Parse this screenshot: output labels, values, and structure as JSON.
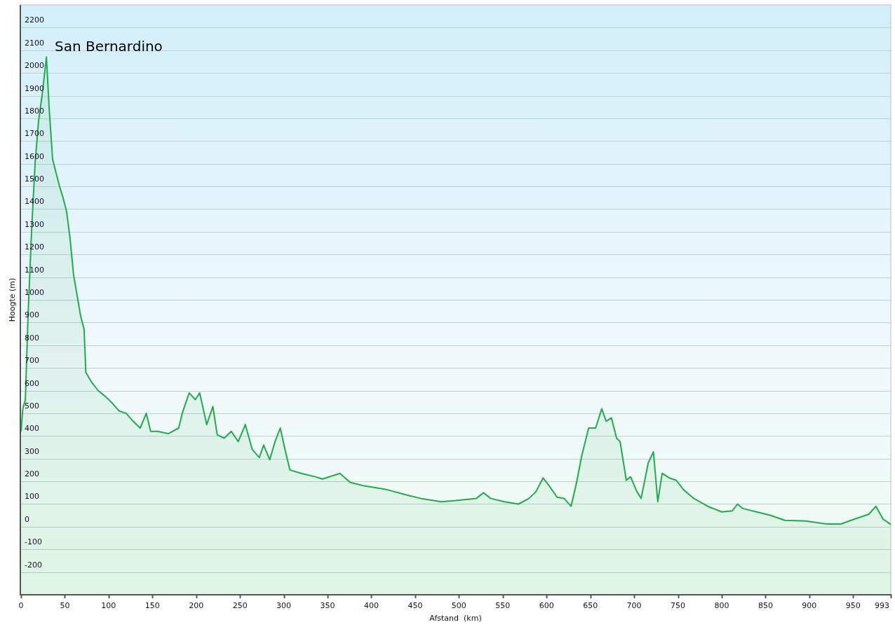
{
  "chart": {
    "chart_data": {
      "type": "line",
      "title": "San Bernardino",
      "xlabel": "Afstand  (km)",
      "ylabel": "Hoogte (m)",
      "grid": true,
      "xlim": [
        0,
        993
      ],
      "ylim": [
        -300,
        2300
      ],
      "xticks": [
        0,
        50,
        100,
        150,
        200,
        250,
        300,
        350,
        400,
        450,
        500,
        550,
        600,
        650,
        700,
        750,
        800,
        850,
        900,
        950,
        993
      ],
      "yticks": [
        -200,
        -100,
        0,
        100,
        200,
        300,
        400,
        500,
        600,
        700,
        800,
        900,
        1000,
        1100,
        1200,
        1300,
        1400,
        1500,
        1600,
        1700,
        1800,
        1900,
        2000,
        2100,
        2200
      ],
      "x": [
        0,
        2,
        5,
        8,
        12,
        16,
        20,
        24,
        29,
        32,
        36,
        40,
        44,
        48,
        52,
        56,
        60,
        64,
        68,
        72,
        74,
        80,
        88,
        96,
        104,
        112,
        120,
        128,
        136,
        143,
        148,
        156,
        168,
        180,
        184,
        192,
        199,
        204,
        212,
        219,
        224,
        232,
        240,
        248,
        256,
        264,
        272,
        277,
        284,
        290,
        296,
        302,
        307,
        320,
        336,
        344,
        356,
        364,
        376,
        392,
        416,
        440,
        456,
        480,
        496,
        520,
        528,
        536,
        552,
        568,
        580,
        588,
        596,
        604,
        612,
        620,
        628,
        634,
        640,
        648,
        656,
        663,
        668,
        674,
        680,
        684,
        691,
        696,
        703,
        708,
        716,
        722,
        727,
        732,
        740,
        748,
        756,
        768,
        784,
        800,
        812,
        818,
        824,
        840,
        856,
        872,
        896,
        920,
        936,
        952,
        968,
        976,
        984,
        993
      ],
      "series": [
        {
          "color": "#22aa4c",
          "values": [
            420,
            520,
            560,
            930,
            1300,
            1600,
            1790,
            1900,
            2070,
            1850,
            1620,
            1560,
            1500,
            1450,
            1390,
            1270,
            1110,
            1020,
            930,
            870,
            680,
            640,
            600,
            575,
            545,
            510,
            500,
            465,
            435,
            500,
            420,
            420,
            410,
            435,
            500,
            590,
            560,
            590,
            450,
            530,
            405,
            390,
            420,
            375,
            450,
            340,
            305,
            360,
            295,
            375,
            435,
            330,
            250,
            235,
            220,
            210,
            225,
            235,
            195,
            180,
            165,
            140,
            125,
            110,
            115,
            125,
            150,
            125,
            110,
            100,
            125,
            155,
            215,
            175,
            130,
            125,
            90,
            190,
            310,
            435,
            435,
            520,
            465,
            480,
            390,
            375,
            205,
            220,
            155,
            125,
            280,
            330,
            110,
            235,
            215,
            205,
            165,
            125,
            90,
            65,
            70,
            100,
            80,
            65,
            50,
            28,
            25,
            12,
            12,
            34,
            55,
            90,
            34,
            10
          ]
        }
      ]
    }
  }
}
